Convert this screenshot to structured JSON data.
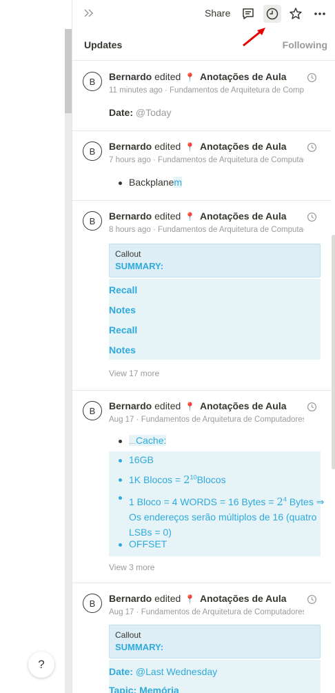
{
  "help": {
    "label": "?"
  },
  "topbar": {
    "share_label": "Share"
  },
  "tabs": {
    "updates": "Updates",
    "following": "Following"
  },
  "updates": [
    {
      "avatar": "B",
      "user": "Bernardo",
      "action": "edited",
      "page": "Anotações de Aula",
      "time": "11 minutes ago",
      "path": "Fundamentos de Arquitetura de Computadores",
      "date_label": "Date:",
      "date_value": "@Today"
    },
    {
      "avatar": "B",
      "user": "Bernardo",
      "action": "edited",
      "page": "Anotações de Aula",
      "time": "7 hours ago",
      "path": "Fundamentos de Arquitetura de Computadores",
      "bullet_text": "Backplane",
      "bullet_added": "m"
    },
    {
      "avatar": "B",
      "user": "Bernardo",
      "action": "edited",
      "page": "Anotações de Aula",
      "time": "8 hours ago",
      "path": "Fundamentos de Arquitetura de Computadores",
      "callout_label": "Callout",
      "callout_title": "SUMMARY:",
      "lines": [
        "Recall",
        "Notes",
        "Recall",
        "Notes"
      ],
      "more": "View 17 more"
    },
    {
      "avatar": "B",
      "user": "Bernardo",
      "action": "edited",
      "page": "Anotações de Aula",
      "time": "Aug 17",
      "path": "Fundamentos de Arquitetura de Computadores",
      "bullets": {
        "cache_prefix": "....",
        "cache": "Cache:",
        "b1": "16GB",
        "b2_pre": "1K Blocos = ",
        "b2_base": "2",
        "b2_exp": "10",
        "b2_post": "Blocos",
        "b3_pre": "1 Bloco = 4 WORDS = 16 Bytes = ",
        "b3_base": "2",
        "b3_exp": "4",
        "b3_post": " Bytes ⇒",
        "b3_line2": "Os endereços serão múltiplos de 16 (quatro",
        "b3_line3": "LSBs = 0)",
        "b4": "OFFSET"
      },
      "more": "View 3 more"
    },
    {
      "avatar": "B",
      "user": "Bernardo",
      "action": "edited",
      "page": "Anotações de Aula",
      "time": "Aug 17",
      "path": "Fundamentos de Arquitetura de Computadores",
      "callout_label": "Callout",
      "callout_title": "SUMMARY:",
      "date_label": "Date:",
      "date_value": "@Last Wednesday",
      "cut_text": "Tapic: Memória"
    }
  ],
  "colors": {
    "accent": "#2eaadc",
    "highlight": "#e6f3f7",
    "annotation_arrow": "#e60000"
  },
  "icons": [
    "double-chevron-right-icon",
    "comment-icon",
    "clock-icon",
    "star-icon",
    "more-icon",
    "pin-icon"
  ]
}
